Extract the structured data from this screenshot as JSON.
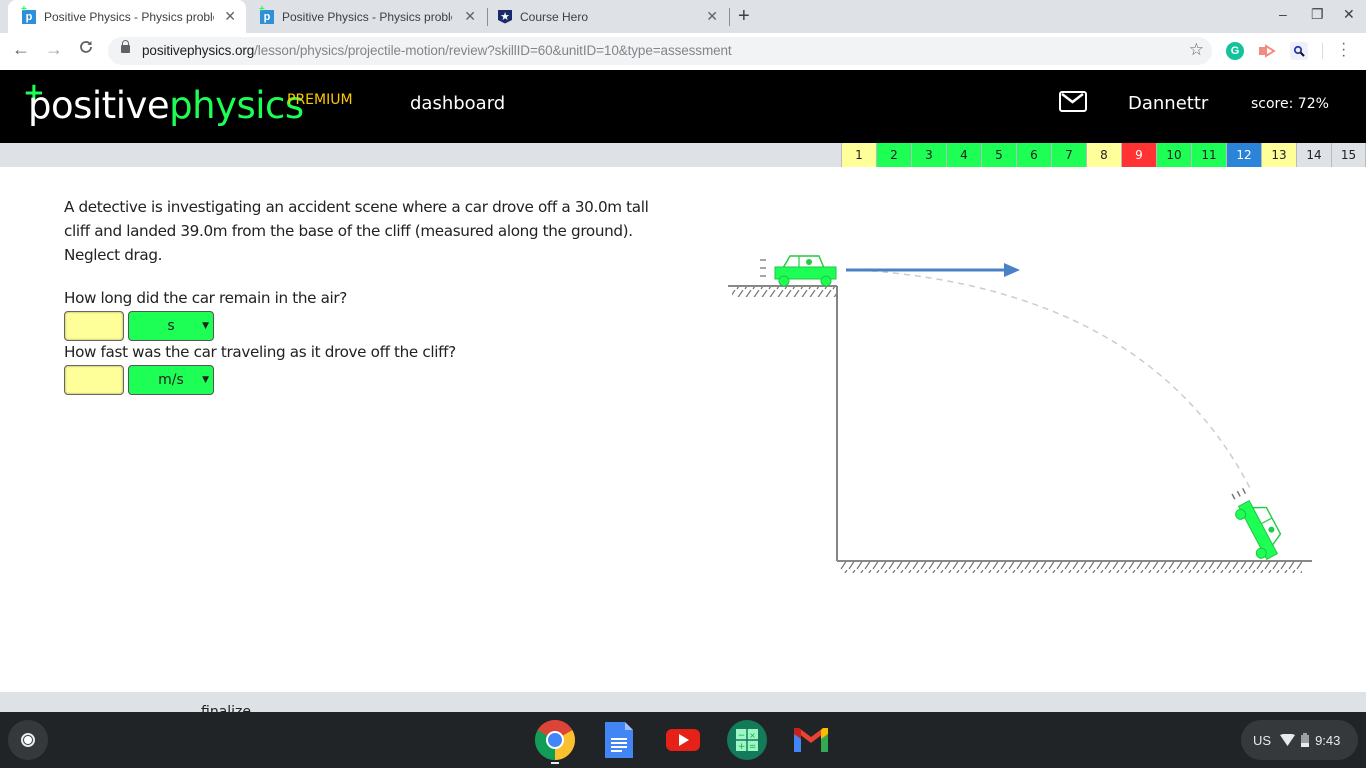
{
  "browser": {
    "tabs": [
      {
        "title": "Positive Physics - Physics proble",
        "favicon": "positive-physics-favicon",
        "active": true
      },
      {
        "title": "Positive Physics - Physics proble",
        "favicon": "positive-physics-favicon",
        "active": false
      },
      {
        "title": "Course Hero",
        "favicon": "course-hero-favicon",
        "active": false
      }
    ],
    "new_tab_label": "+",
    "url_host": "positivephysics.org",
    "url_path": "/lesson/physics/projectile-motion/review?skillID=60&unitID=10&type=assessment",
    "window_controls": {
      "minimize": "–",
      "restore": "❐",
      "close": "✕"
    },
    "nav": {
      "back": "←",
      "forward": "→",
      "reload": "C"
    },
    "extensions": [
      "grammarly-icon",
      "screencastify-icon",
      "search-extension-icon"
    ]
  },
  "site": {
    "logo_part1": "positive",
    "logo_part2": "physics",
    "logo_plus": "+",
    "premium_label": "PREMIUM",
    "dashboard_label": "dashboard",
    "username": "Dannettr",
    "score_label": "score: 72%",
    "colors": {
      "green": "#1eff55",
      "yellow": "#ffff99",
      "red": "#ff3333",
      "blue": "#2a85d8",
      "gray": "#dee1e6",
      "premium": "#ffc800"
    }
  },
  "progress": [
    {
      "n": "1",
      "status": "yellow"
    },
    {
      "n": "2",
      "status": "green"
    },
    {
      "n": "3",
      "status": "green"
    },
    {
      "n": "4",
      "status": "green"
    },
    {
      "n": "5",
      "status": "green"
    },
    {
      "n": "6",
      "status": "green"
    },
    {
      "n": "7",
      "status": "green"
    },
    {
      "n": "8",
      "status": "yellow"
    },
    {
      "n": "9",
      "status": "red"
    },
    {
      "n": "10",
      "status": "green"
    },
    {
      "n": "11",
      "status": "green"
    },
    {
      "n": "12",
      "status": "current"
    },
    {
      "n": "13",
      "status": "yellow"
    },
    {
      "n": "14",
      "status": "gray"
    },
    {
      "n": "15",
      "status": "gray"
    }
  ],
  "question": {
    "text": "A detective is investigating an accident scene where a car drove off a 30.0m tall cliff and landed 39.0m from the base of the cliff (measured along the ground). Neglect drag.",
    "parts": [
      {
        "prompt": "How long did the car remain in the air?",
        "value": "",
        "unit": "s"
      },
      {
        "prompt": "How fast was the car traveling as it drove off the cliff?",
        "value": "",
        "unit": "m/s"
      }
    ]
  },
  "footer": {
    "finalize_label": "finalize"
  },
  "shelf": {
    "apps": [
      "chrome-icon",
      "google-docs-icon",
      "youtube-icon",
      "calculator-icon",
      "gmail-icon"
    ],
    "locale": "US",
    "time": "9:43"
  }
}
